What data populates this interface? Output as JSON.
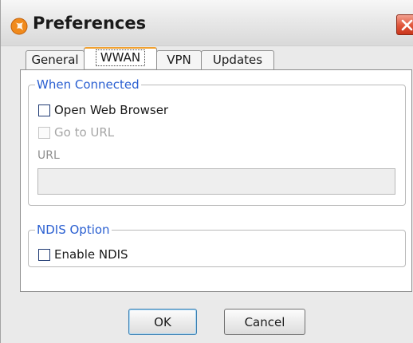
{
  "window": {
    "title": "Preferences",
    "app_icon": "orange-app-icon",
    "close_icon": "close-x-icon",
    "close_color": "#e0553a"
  },
  "tabs": [
    {
      "label": "General",
      "active": false
    },
    {
      "label": "WWAN",
      "active": true
    },
    {
      "label": "VPN",
      "active": false
    },
    {
      "label": "Updates",
      "active": false
    }
  ],
  "when_connected": {
    "title": "When Connected",
    "open_web_browser": {
      "label": "Open Web Browser",
      "checked": false,
      "enabled": true
    },
    "go_to_url": {
      "label": "Go to URL",
      "checked": false,
      "enabled": false
    },
    "url_label": "URL",
    "url_value": ""
  },
  "ndis_option": {
    "title": "NDIS Option",
    "enable_ndis": {
      "label": "Enable NDIS",
      "checked": false,
      "enabled": true
    }
  },
  "buttons": {
    "ok": "OK",
    "cancel": "Cancel"
  },
  "colors": {
    "group_title": "#2a5fd1",
    "active_tab_accent": "#f0a030"
  }
}
